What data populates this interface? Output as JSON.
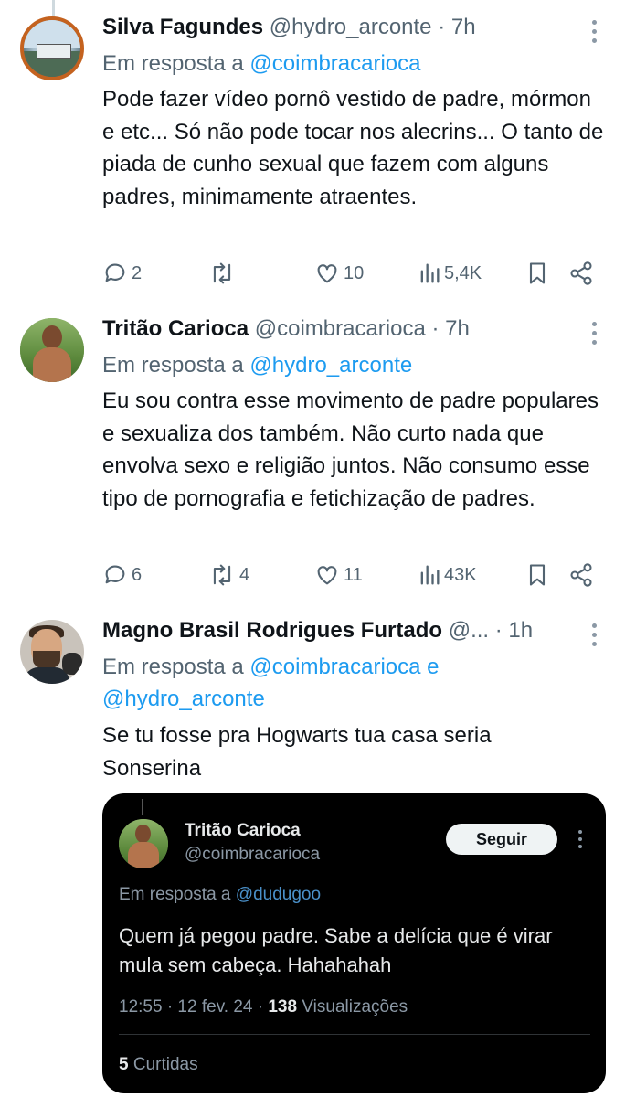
{
  "tweets": [
    {
      "name": "Silva Fagundes",
      "handle": "@hydro_arconte",
      "time": "· 7h",
      "reply_prefix": "Em resposta a",
      "reply_to": "@coimbracarioca",
      "text": "Pode fazer vídeo pornô vestido de padre, mórmon e etc... Só não pode tocar nos alecrins... O tanto de piada de cunho sexual que fazem com alguns padres, minimamente atraentes.",
      "replies": "2",
      "reposts": "",
      "likes": "10",
      "views": "5,4K"
    },
    {
      "name": "Tritão Carioca",
      "handle": "@coimbracarioca",
      "time": "· 7h",
      "reply_prefix": "Em resposta a",
      "reply_to": "@hydro_arconte",
      "text": "Eu sou contra esse movimento de padre populares e sexualiza dos também. Não curto nada que envolva sexo e religião juntos. Não consumo esse tipo de pornografia e fetichização de padres.",
      "replies": "6",
      "reposts": "4",
      "likes": "11",
      "views": "43K"
    },
    {
      "name": "Magno Brasil Rodrigues Furtado",
      "handle": "@...",
      "time": "· 1h",
      "reply_prefix": "Em resposta a",
      "reply_to": "@coimbracarioca",
      "reply_and": "e",
      "reply_to_2": "@hydro_arconte",
      "text_line1": "Se tu fosse pra Hogwarts tua casa seria",
      "text_line2": "Sonserina"
    }
  ],
  "embedded": {
    "name": "Tritão Carioca",
    "handle": "@coimbracarioca",
    "follow_label": "Seguir",
    "reply_prefix": "Em resposta a",
    "reply_to": "@dudugoo",
    "text": "Quem já pegou padre. Sabe a delícia que é virar mula sem cabeça. Hahahahah",
    "meta_time": "12:55 · 12 fev. 24 ·",
    "meta_views_count": "138",
    "meta_views_label": "Visualizações",
    "likes_count": "5",
    "likes_label": "Curtidas"
  },
  "icons": [
    "reply-icon",
    "repost-icon",
    "like-icon",
    "views-icon",
    "bookmark-icon",
    "share-icon",
    "more-icon"
  ],
  "colors": {
    "link": "#1d9bf0",
    "muted": "#536471",
    "card_bg": "#000000"
  }
}
